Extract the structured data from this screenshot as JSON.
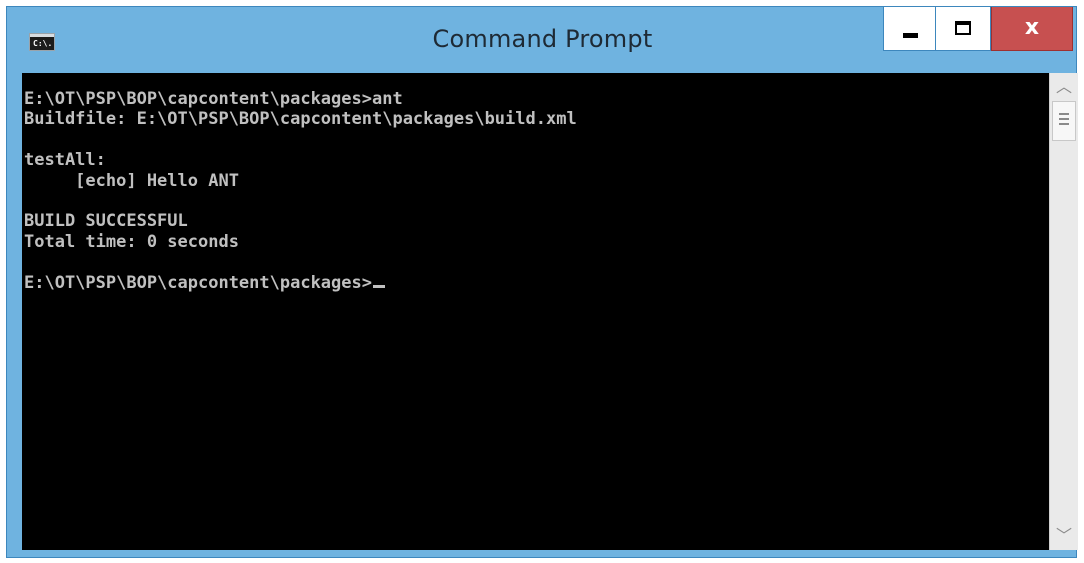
{
  "window": {
    "title": "Command Prompt",
    "icon_label": "C:\\.",
    "controls": {
      "minimize_icon": "minimize-icon",
      "maximize_icon": "maximize-icon",
      "close_symbol": "x"
    },
    "colors": {
      "frame": "#6fb3e0",
      "close": "#c75050",
      "console_bg": "#000000",
      "console_fg": "#c0c0c0"
    }
  },
  "console": {
    "lines": [
      "E:\\OT\\PSP\\BOP\\capcontent\\packages>ant",
      "Buildfile: E:\\OT\\PSP\\BOP\\capcontent\\packages\\build.xml",
      "",
      "testAll:",
      "     [echo] Hello ANT",
      "",
      "BUILD SUCCESSFUL",
      "Total time: 0 seconds",
      "",
      "E:\\OT\\PSP\\BOP\\capcontent\\packages>"
    ]
  },
  "scrollbar": {
    "up_arrow": "^",
    "down_arrow": "v"
  }
}
